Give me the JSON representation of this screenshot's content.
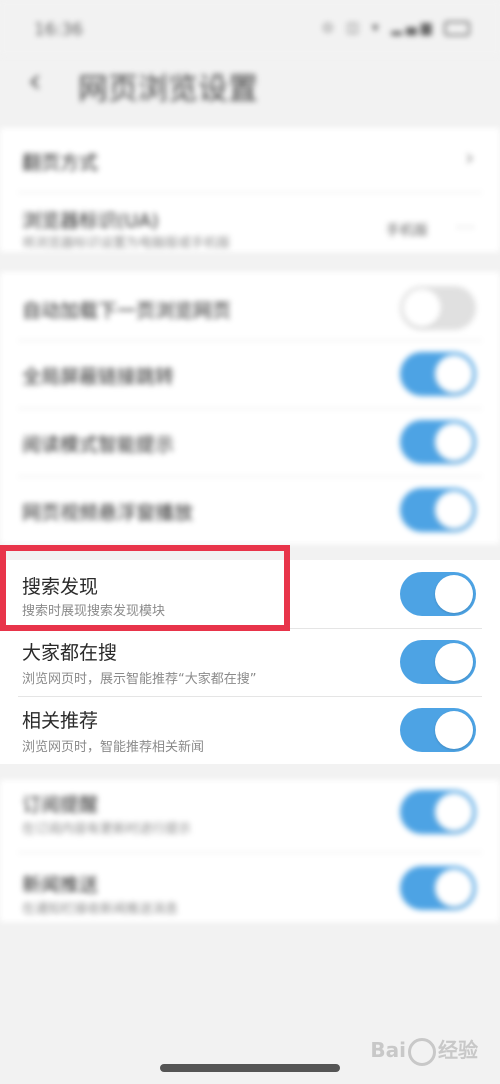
{
  "status_bar": {
    "time": "16:36",
    "icons": "⊙ ◫ ▾ ▂▄▆"
  },
  "header": {
    "title": "网页浏览设置"
  },
  "section1": {
    "row1": {
      "title": "翻页方式"
    },
    "row2": {
      "title": "浏览器标识(UA)",
      "subtitle": "将浏览器标识设置为电脑版或手机版",
      "value": "手机版"
    }
  },
  "section2": {
    "rows": [
      {
        "title": "自动加载下一页浏览网页",
        "on": false
      },
      {
        "title": "全局屏蔽链接跳转",
        "on": true
      },
      {
        "title": "阅读模式智能提示",
        "on": true
      },
      {
        "title": "网页视频悬浮窗播放",
        "on": true
      }
    ]
  },
  "section3": {
    "rows": [
      {
        "title": "搜索发现",
        "subtitle": "搜索时展现搜索发现模块",
        "on": true
      },
      {
        "title": "大家都在搜",
        "subtitle": "浏览网页时，展示智能推荐“大家都在搜”",
        "on": true
      },
      {
        "title": "相关推荐",
        "subtitle": "浏览网页时，智能推荐相关新闻",
        "on": true
      }
    ]
  },
  "section4": {
    "rows": [
      {
        "title": "订阅提醒",
        "subtitle": "在订阅内容有更新时进行提示",
        "on": true
      },
      {
        "title": "新闻推送",
        "subtitle": "在通知栏接收新闻推送消息",
        "on": true
      }
    ]
  },
  "watermark": {
    "text_a": "Bai",
    "text_b": "经验"
  },
  "colors": {
    "toggle_on": "#4da3e4",
    "highlight": "#e8344a"
  }
}
